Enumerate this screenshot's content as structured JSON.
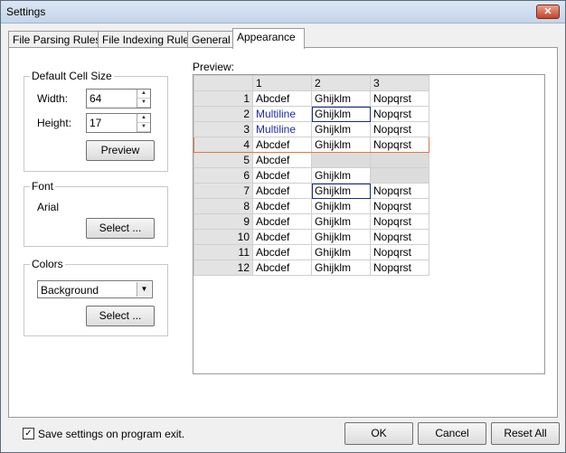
{
  "window": {
    "title": "Settings",
    "close": "✕"
  },
  "tabs": [
    {
      "label": "File Parsing Rules"
    },
    {
      "label": "File Indexing Rules"
    },
    {
      "label": "General"
    },
    {
      "label": "Appearance"
    }
  ],
  "cell_size": {
    "label": "Default Cell Size",
    "width_label": "Width:",
    "width_value": "64",
    "height_label": "Height:",
    "height_value": "17",
    "preview_button": "Preview"
  },
  "font": {
    "label": "Font",
    "value": "Arial",
    "select_button": "Select ..."
  },
  "colors": {
    "label": "Colors",
    "selected": "Background",
    "select_button": "Select ..."
  },
  "preview": {
    "label": "Preview:",
    "columns": [
      "1",
      "2",
      "3"
    ],
    "rows": [
      {
        "n": "1",
        "c": [
          "Abcdef",
          "Ghijklm",
          "Nopqrst"
        ]
      },
      {
        "n": "2",
        "c": [
          "Multiline",
          "Ghijklm",
          "Nopqrst"
        ]
      },
      {
        "n": "3",
        "c": [
          "Multiline",
          "Ghijklm",
          "Nopqrst"
        ]
      },
      {
        "n": "4",
        "c": [
          "Abcdef",
          "Ghijklm",
          "Nopqrst"
        ]
      },
      {
        "n": "5",
        "c": [
          "Abcdef",
          "",
          ""
        ]
      },
      {
        "n": "6",
        "c": [
          "Abcdef",
          "Ghijklm",
          ""
        ]
      },
      {
        "n": "7",
        "c": [
          "Abcdef",
          "Ghijklm",
          "Nopqrst"
        ]
      },
      {
        "n": "8",
        "c": [
          "Abcdef",
          "Ghijklm",
          "Nopqrst"
        ]
      },
      {
        "n": "9",
        "c": [
          "Abcdef",
          "Ghijklm",
          "Nopqrst"
        ]
      },
      {
        "n": "10",
        "c": [
          "Abcdef",
          "Ghijklm",
          "Nopqrst"
        ]
      },
      {
        "n": "11",
        "c": [
          "Abcdef",
          "Ghijklm",
          "Nopqrst"
        ]
      },
      {
        "n": "12",
        "c": [
          "Abcdef",
          "Ghijklm",
          "Nopqrst"
        ]
      }
    ]
  },
  "bottom": {
    "save_checkbox_label": "Save settings on program exit.",
    "ok": "OK",
    "cancel": "Cancel",
    "reset_all": "Reset All"
  }
}
